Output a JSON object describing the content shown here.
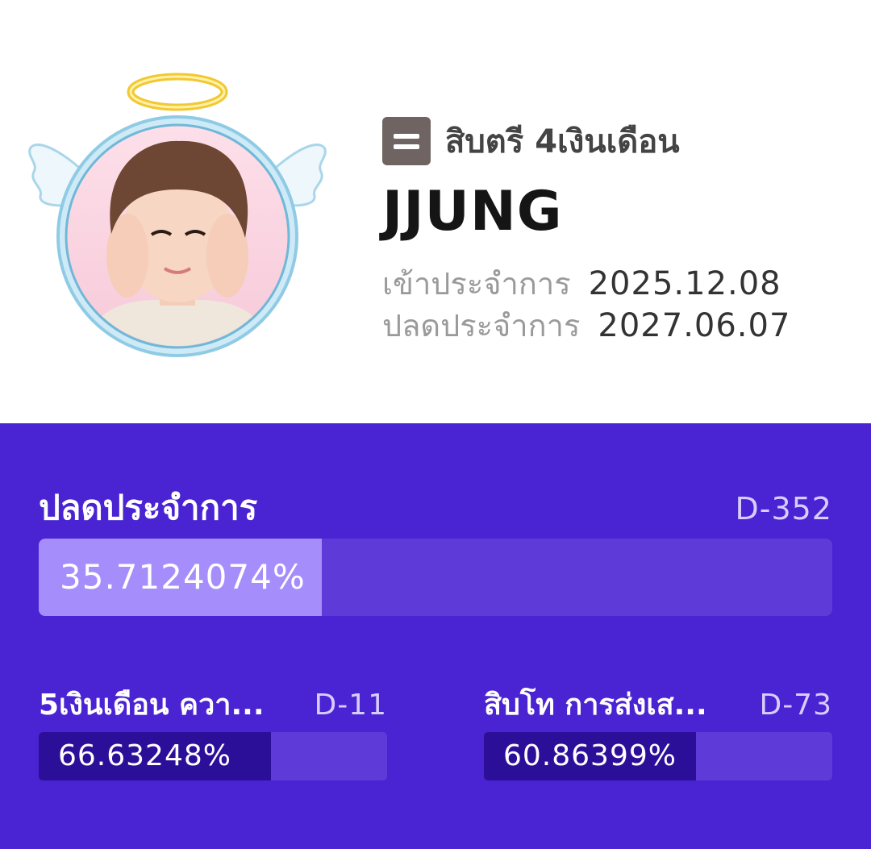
{
  "profile": {
    "rank": "สิบตรี 4เงินเดือน",
    "name": "JJUNG",
    "enlist_label": "เข้าประจำการ",
    "enlist_date": "2025.12.08",
    "discharge_label": "ปลดประจำการ",
    "discharge_date": "2027.06.07",
    "avatar": "angel-frame-avatar-photo"
  },
  "progress": {
    "title": "ปลดประจำการ",
    "dday": "D-352",
    "percent_text": "35.7124074%",
    "percent": 35.7124074
  },
  "sub_progress": [
    {
      "title": "5เงินเดือน ควา...",
      "dday": "D-11",
      "percent_text": "66.63248%",
      "percent": 66.63248
    },
    {
      "title": "สิบโท การส่งเส...",
      "dday": "D-73",
      "percent_text": "60.86399%",
      "percent": 60.86399
    }
  ],
  "colors": {
    "panel": "#4a23d2",
    "track": "#5e3ad9",
    "main_fill": "#a58dfc",
    "sub_fill": "#2c0f99",
    "badge": "#6f6461"
  }
}
